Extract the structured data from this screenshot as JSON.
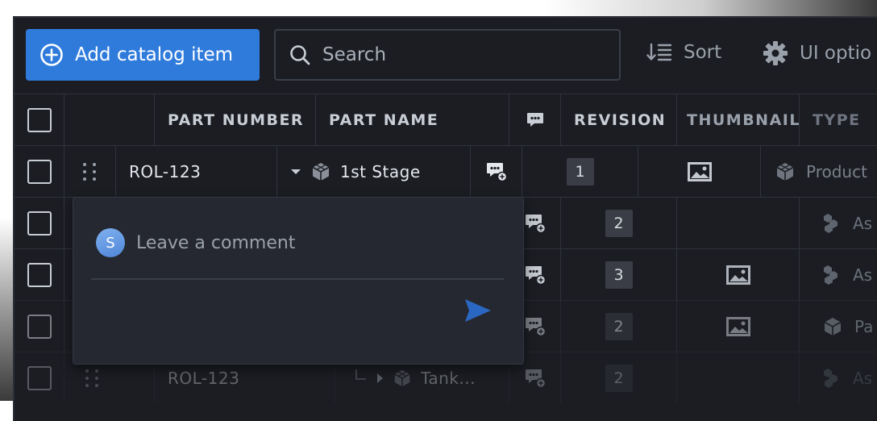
{
  "toolbar": {
    "add_label": "Add catalog item",
    "search_placeholder": "Search",
    "sort_label": "Sort",
    "ui_options_label": "UI optio"
  },
  "table": {
    "headers": [
      "PART NUMBER",
      "PART NAME",
      "REVISION",
      "THUMBNAIL",
      "TYPE"
    ],
    "rows": [
      {
        "part_number": "ROL-123",
        "part_name": "1st Stage",
        "revision": "1",
        "type": "Product"
      },
      {
        "revision": "2",
        "type": "As"
      },
      {
        "revision": "3",
        "type": "As"
      },
      {
        "revision": "2",
        "type": "Pa"
      },
      {
        "part_number": "ROL-123",
        "part_name": "Tank...",
        "revision": "2",
        "type": "As"
      }
    ]
  },
  "comment": {
    "avatar_initial": "S",
    "placeholder": "Leave a comment"
  },
  "colors": {
    "accent": "#2f7bdc",
    "background": "#1b1d23",
    "popup": "#252830"
  }
}
